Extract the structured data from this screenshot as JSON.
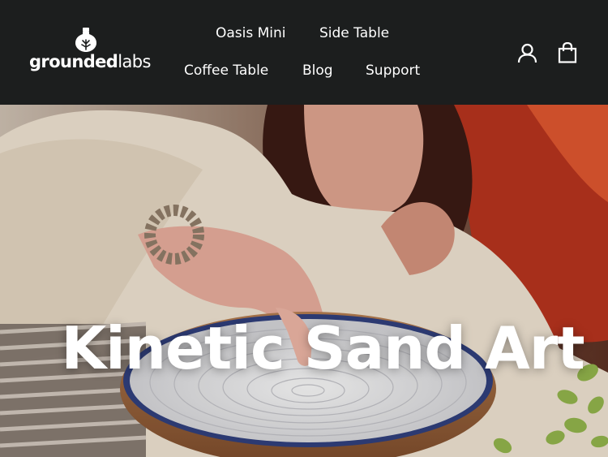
{
  "brand": {
    "name_bold": "grounded",
    "name_light": "labs"
  },
  "nav": {
    "items": [
      {
        "label": "Oasis Mini"
      },
      {
        "label": "Side Table"
      },
      {
        "label": "Coffee Table"
      },
      {
        "label": "Blog"
      },
      {
        "label": "Support"
      }
    ]
  },
  "header_actions": {
    "account_icon": "user-icon",
    "cart_icon": "shopping-bag-icon"
  },
  "hero": {
    "title": "Kinetic Sand Art"
  },
  "colors": {
    "header_bg": "#1c1e1e",
    "text": "#ffffff"
  }
}
